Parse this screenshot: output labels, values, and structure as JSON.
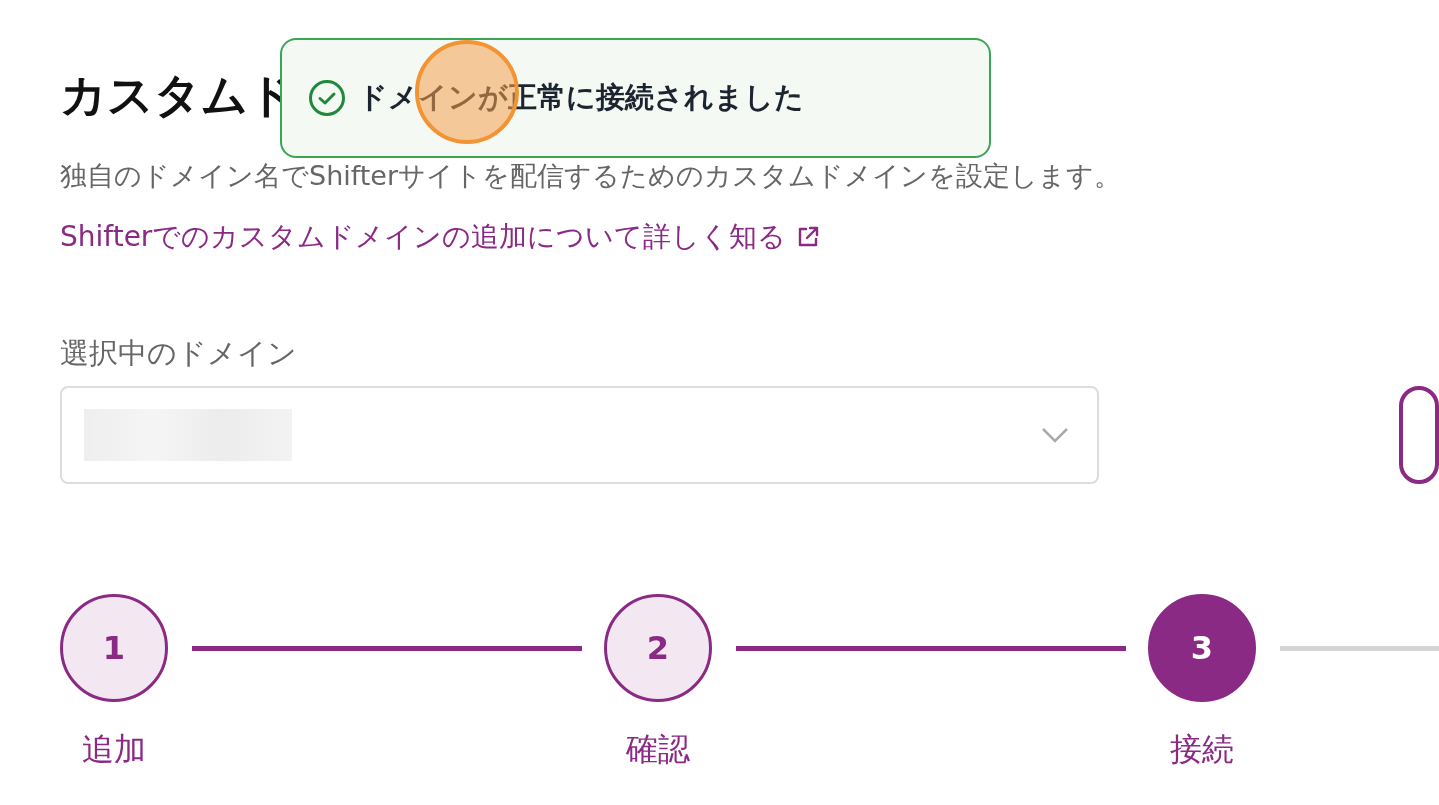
{
  "header": {
    "title": "カスタムド",
    "description": "独自のドメイン名でShifterサイトを配信するためのカスタムドメインを設定します。",
    "help_link": "Shifterでのカスタムドメインの追加について詳しく知る"
  },
  "domain_select": {
    "label": "選択中のドメイン",
    "value_redacted": true
  },
  "side_button": {
    "kind": "outline"
  },
  "stepper": {
    "continues": true,
    "steps": [
      {
        "number": "1",
        "label": "追加",
        "selected": false,
        "completed": true
      },
      {
        "number": "2",
        "label": "確認",
        "selected": false,
        "completed": true
      },
      {
        "number": "3",
        "label": "接続",
        "selected": true,
        "completed": false
      }
    ]
  },
  "toast": {
    "kind": "success",
    "message": "ドメインが正常に接続されました"
  },
  "click_marker": true
}
